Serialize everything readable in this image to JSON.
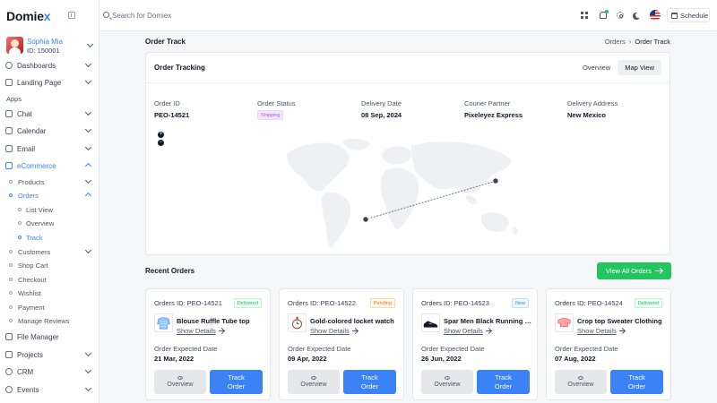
{
  "brand": {
    "name_main": "Domie",
    "name_accent": "x"
  },
  "profile": {
    "name": "Sophia Mia",
    "id": "ID: 150001"
  },
  "sidebar": {
    "dashboards": "Dashboards",
    "landing": "Landing Page",
    "apps_label": "Apps",
    "chat": "Chat",
    "calendar": "Calendar",
    "email": "Email",
    "ecommerce": "eCommerce",
    "products": "Products",
    "orders": "Orders",
    "list_view": "List View",
    "overview": "Overview",
    "track": "Track",
    "customers": "Customers",
    "shop_cart": "Shop Cart",
    "checkout": "Checkout",
    "wishlist": "Wishlist",
    "payment": "Payment",
    "manage_reviews": "Manage Reviews",
    "file_manager": "File Manager",
    "projects": "Projects",
    "crm": "CRM",
    "events": "Events"
  },
  "header": {
    "search_placeholder": "Search for Domiex",
    "schedule": "Schedule"
  },
  "page": {
    "title": "Order Track",
    "breadcrumb_parent": "Orders",
    "breadcrumb_current": "Order Track"
  },
  "tracking": {
    "title": "Order Tracking",
    "tab_overview": "Overview",
    "tab_map": "Map View",
    "order_id_label": "Order ID",
    "order_id": "PEO-14521",
    "status_label": "Order Status",
    "status": "Shipping",
    "delivery_date_label": "Delivery Date",
    "delivery_date": "08 Sep, 2024",
    "courier_label": "Courier Partner",
    "courier": "Pixeleyez Express",
    "address_label": "Delivery Address",
    "address": "New Mexico",
    "zoom_in": "+",
    "zoom_out": "−"
  },
  "recent": {
    "title": "Recent Orders",
    "view_all": "View All Orders",
    "expected_label": "Order Expected Date",
    "overview_btn": "Overview",
    "track_btn": "Track Order",
    "show_details": "Show Details",
    "orders": [
      {
        "id": "Orders ID: PEO-14521",
        "status": "Delivered",
        "product": "Blouse Ruffle Tube top",
        "date": "21 Mar, 2022"
      },
      {
        "id": "Orders ID: PEO-14522",
        "status": "Pending",
        "product": "Gold-colored locket watch",
        "date": "09 Apr, 2022"
      },
      {
        "id": "Orders ID: PEO-14523",
        "status": "New",
        "product": "Spar Men Black Running Shoes",
        "date": "26 Jun, 2022"
      },
      {
        "id": "Orders ID: PEO-14524",
        "status": "Delivered",
        "product": "Crop top Sweater Clothing",
        "date": "07 Aug, 2022"
      }
    ]
  },
  "colors": {
    "primary": "#3b82f6",
    "success": "#22c55e",
    "shipping": "#a855f7",
    "pending": "#f97316"
  }
}
